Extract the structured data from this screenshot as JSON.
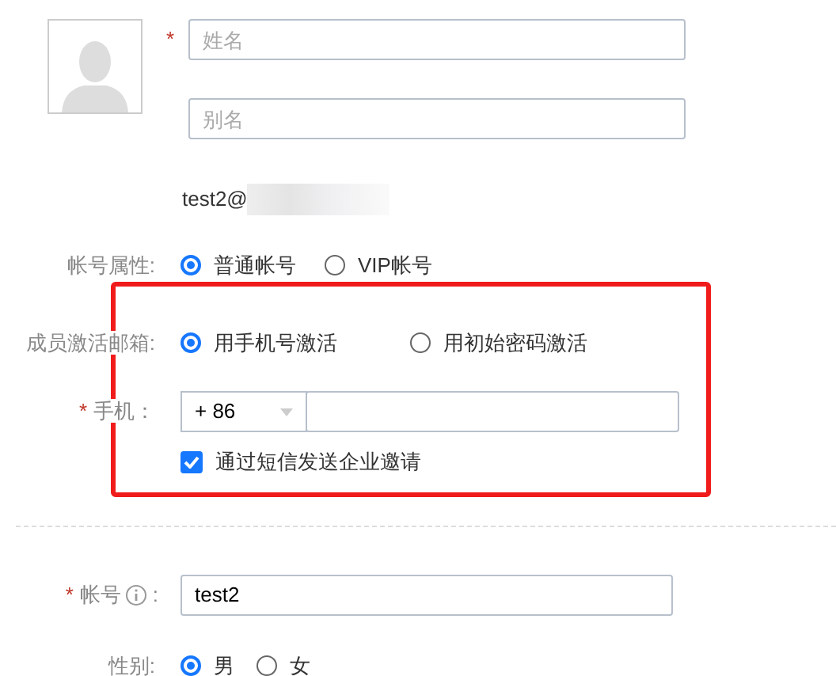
{
  "name_field": {
    "placeholder": "姓名",
    "required_mark": "*"
  },
  "alias_field": {
    "placeholder": "别名"
  },
  "email": {
    "text": "test2@",
    "redacted": true
  },
  "account_type": {
    "label": "帐号属性:",
    "options": [
      {
        "label": "普通帐号",
        "selected": true
      },
      {
        "label": "VIP帐号",
        "selected": false
      }
    ]
  },
  "activation": {
    "label": "成员激活邮箱:",
    "options": [
      {
        "label": "用手机号激活",
        "selected": true
      },
      {
        "label": "用初始密码激活",
        "selected": false
      }
    ]
  },
  "phone": {
    "required_mark": "*",
    "label": "手机：",
    "country_code": "+ 86"
  },
  "sms_invite": {
    "label": "通过短信发送企业邀请",
    "checked": true
  },
  "highlighted": true,
  "account": {
    "required_mark": "*",
    "label": "帐号",
    "value": "test2",
    "colon": ":"
  },
  "gender": {
    "label": "性别:",
    "options": [
      {
        "label": "男",
        "selected": true
      },
      {
        "label": "女",
        "selected": false
      }
    ]
  }
}
